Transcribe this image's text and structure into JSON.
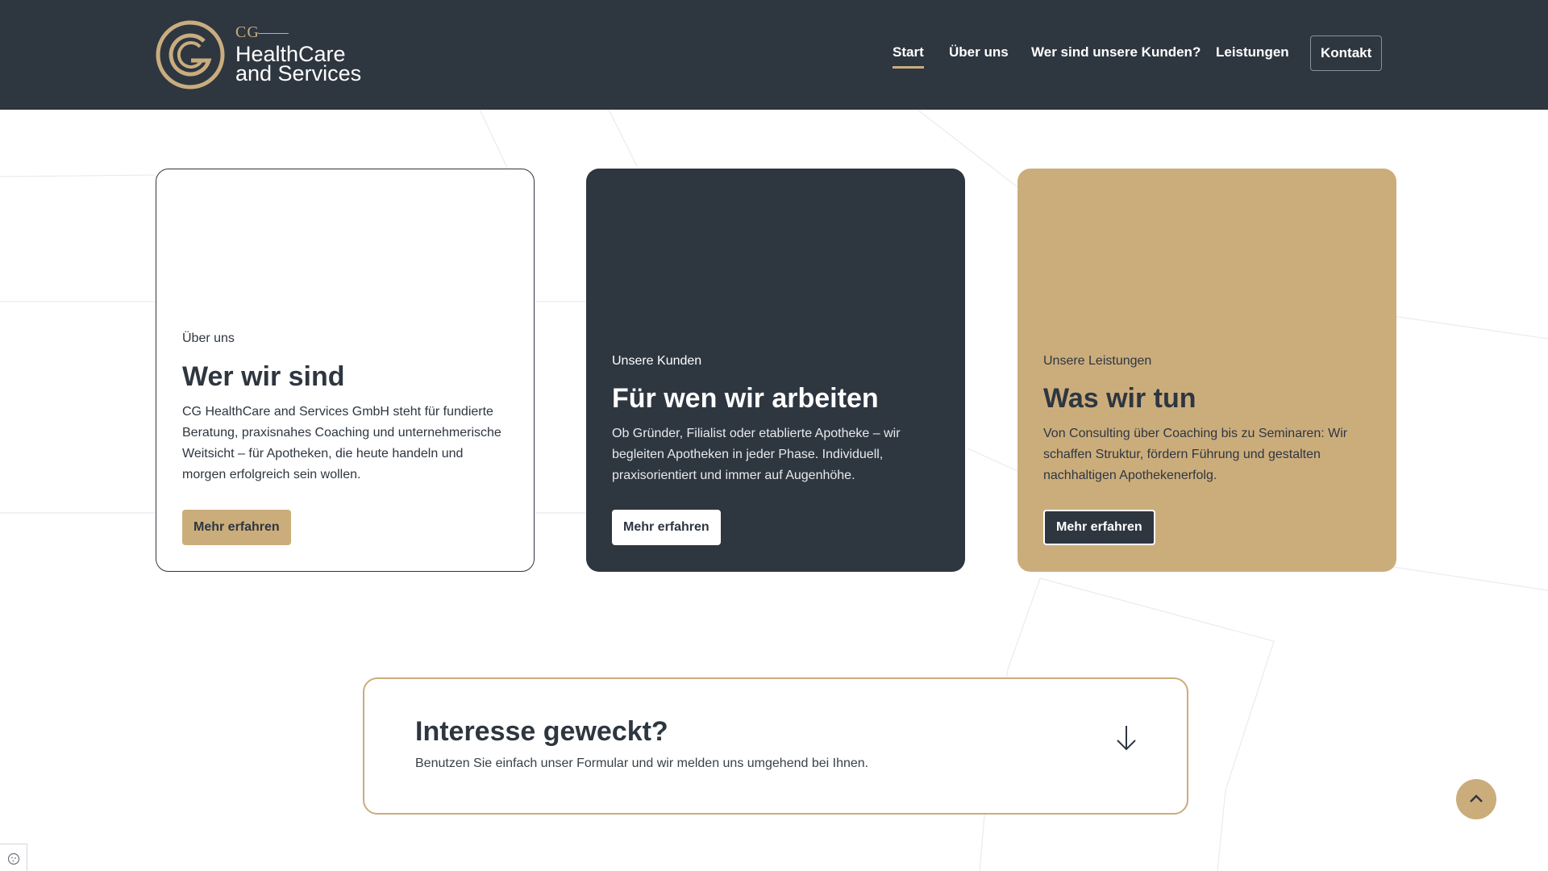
{
  "logo": {
    "mark": "CG",
    "line1": "HealthCare",
    "line2": "and Services"
  },
  "nav": {
    "items": [
      {
        "label": "Start",
        "active": true
      },
      {
        "label": "Über uns",
        "active": false
      },
      {
        "label": "Wer sind unsere Kunden?",
        "active": false
      },
      {
        "label": "Leistungen",
        "active": false
      }
    ],
    "contact_label": "Kontakt"
  },
  "cards": [
    {
      "eyebrow": "Über uns",
      "title": "Wer wir sind",
      "text": "CG HealthCare and Services GmbH steht für fundierte Beratung, praxisnahes Coaching und unternehmerische Weitsicht – für Apotheken, die heute handeln und morgen erfolgreich sein wollen.",
      "button": "Mehr erfahren"
    },
    {
      "eyebrow": "Unsere Kunden",
      "title": "Für wen wir arbeiten",
      "text": "Ob Gründer, Filialist oder etablierte Apotheke – wir begleiten Apotheken in jeder Phase. Individuell, praxisorientiert und immer auf Augenhöhe.",
      "button": "Mehr erfahren"
    },
    {
      "eyebrow": "Unsere Leistungen",
      "title": "Was wir tun",
      "text": "Von Consulting über Coaching bis zu Seminaren: Wir schaffen Struktur, fördern Führung und gestalten nachhaltigen Apothekenerfolg.",
      "button": "Mehr erfahren"
    }
  ],
  "interest": {
    "title": "Interesse geweckt?",
    "text": "Benutzen Sie einfach unser Formular und wir melden uns umgehend bei Ihnen.",
    "icon": "arrow-down-icon"
  },
  "scroll_top_icon": "chevron-up-icon",
  "cookie_icon": "cookie-icon",
  "colors": {
    "dark": "#2e3640",
    "gold": "#cbad7c",
    "white": "#ffffff"
  }
}
